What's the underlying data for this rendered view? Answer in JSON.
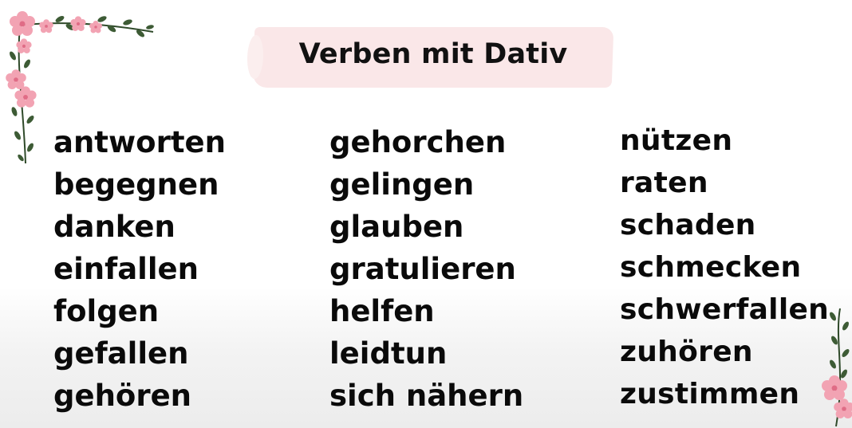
{
  "title": "Verben mit Dativ",
  "columns": [
    [
      "antworten",
      "begegnen",
      "danken",
      "einfallen",
      "folgen",
      "gefallen",
      "gehören"
    ],
    [
      "gehorchen",
      "gelingen",
      "glauben",
      "gratulieren",
      "helfen",
      "leidtun",
      "sich nähern"
    ],
    [
      "nützen",
      "raten",
      "schaden",
      "schmecken",
      "schwerfallen",
      "zuhören",
      "zustimmen"
    ]
  ],
  "decoration": {
    "flower_color": "#f2a3b3",
    "flower_center": "#e06c86",
    "leaf_color": "#2f4a2a",
    "title_highlight": "#fae7e8"
  }
}
